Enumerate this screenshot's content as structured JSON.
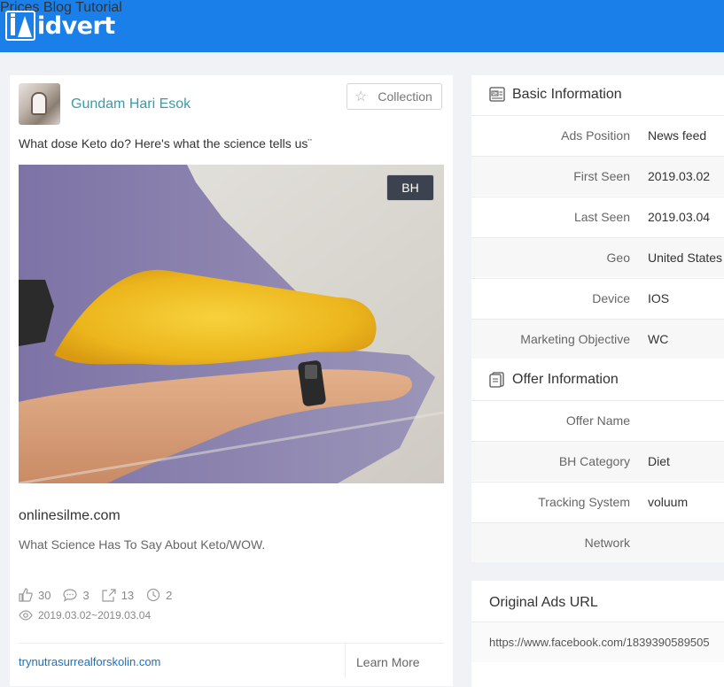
{
  "brand": {
    "logo_text": "idvert"
  },
  "nav": {
    "items": [
      {
        "label": "Prices"
      },
      {
        "label": "Blog"
      },
      {
        "label": "Tutorial"
      }
    ]
  },
  "ad": {
    "username": "Gundam Hari Esok",
    "collection_label": "Collection",
    "post_text": "What dose Keto do? Here's what the science tells us¨",
    "image_badge": "BH",
    "domain": "onlinesilme.com",
    "headline": "What Science Has To Say About Keto/WOW.",
    "stats": {
      "likes": "30",
      "comments": "3",
      "shares": "13",
      "views_time": "2"
    },
    "date_range": "2019.03.02~2019.03.04",
    "landing_link": "trynutrasurrealforskolin.com",
    "cta_label": "Learn More"
  },
  "basic_info": {
    "title": "Basic Information",
    "rows": [
      {
        "label": "Ads Position",
        "value": "News feed"
      },
      {
        "label": "First Seen",
        "value": "2019.03.02"
      },
      {
        "label": "Last Seen",
        "value": "2019.03.04"
      },
      {
        "label": "Geo",
        "value": "United States"
      },
      {
        "label": "Device",
        "value": "IOS"
      },
      {
        "label": "Marketing Objective",
        "value": "WC"
      }
    ]
  },
  "offer_info": {
    "title": "Offer Information",
    "rows": [
      {
        "label": "Offer Name",
        "value": ""
      },
      {
        "label": "BH Category",
        "value": "Diet"
      },
      {
        "label": "Tracking System",
        "value": "voluum"
      },
      {
        "label": "Network",
        "value": ""
      }
    ]
  },
  "original_url": {
    "title": "Original Ads URL",
    "url": "https://www.facebook.com/1839390589505"
  },
  "colors": {
    "topbar": "#1a7fe8",
    "link": "#1d6fbf",
    "username": "#3a9ba8",
    "badge": "#3c4250"
  }
}
